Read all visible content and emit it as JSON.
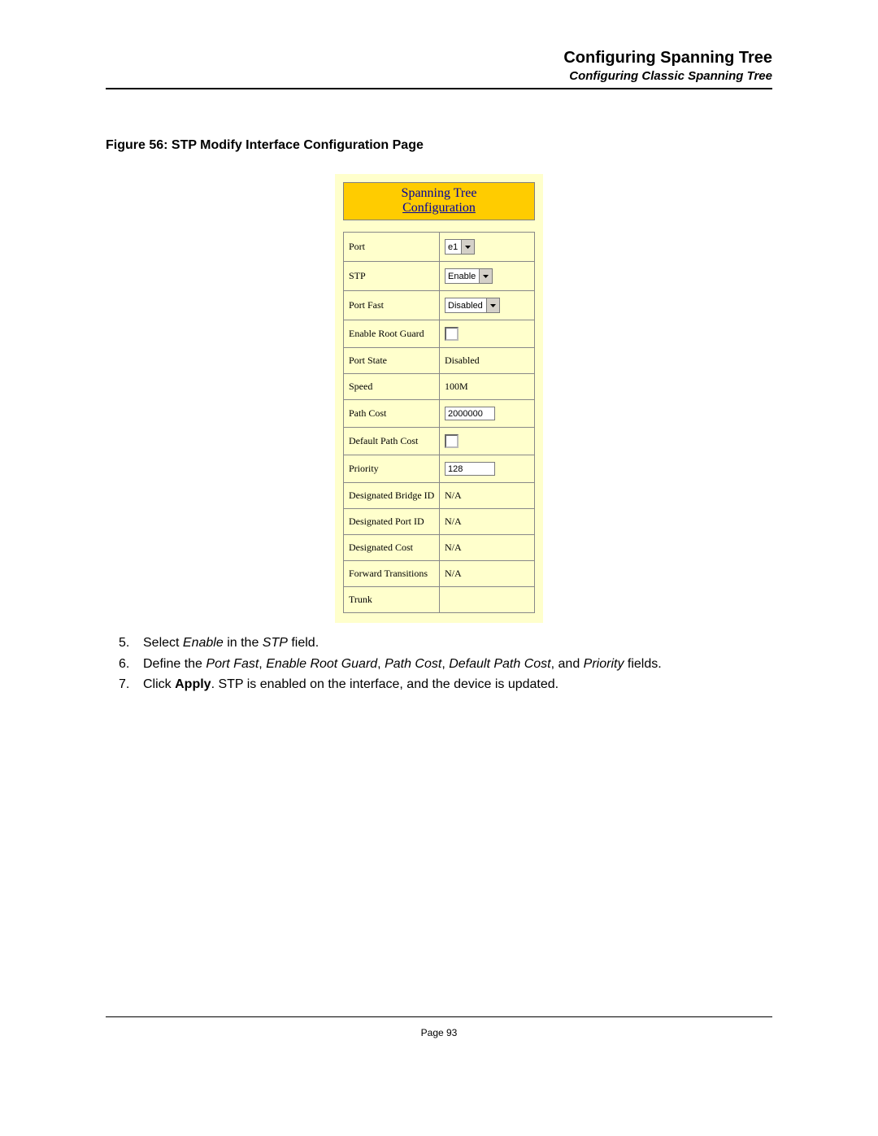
{
  "header": {
    "title": "Configuring Spanning Tree",
    "subtitle": "Configuring Classic Spanning Tree"
  },
  "figure": {
    "caption": "Figure 56:  STP Modify Interface Configuration Page"
  },
  "panel": {
    "title_line1": "Spanning Tree",
    "title_line2": "Configuration",
    "rows": {
      "port": {
        "label": "Port",
        "value": "e1"
      },
      "stp": {
        "label": "STP",
        "value": "Enable"
      },
      "port_fast": {
        "label": "Port Fast",
        "value": "Disabled"
      },
      "root_guard": {
        "label": "Enable Root Guard",
        "checked": false
      },
      "port_state": {
        "label": "Port State",
        "value": "Disabled"
      },
      "speed": {
        "label": "Speed",
        "value": "100M"
      },
      "path_cost": {
        "label": "Path Cost",
        "value": "2000000"
      },
      "default_path_cost": {
        "label": "Default Path Cost",
        "checked": false
      },
      "priority": {
        "label": "Priority",
        "value": "128"
      },
      "des_bridge": {
        "label": "Designated Bridge ID",
        "value": "N/A"
      },
      "des_port": {
        "label": "Designated Port ID",
        "value": "N/A"
      },
      "des_cost": {
        "label": "Designated Cost",
        "value": "N/A"
      },
      "fwd_trans": {
        "label": "Forward Transitions",
        "value": "N/A"
      },
      "trunk": {
        "label": "Trunk",
        "value": ""
      }
    }
  },
  "steps": {
    "s5_num": "5.",
    "s5_a": "Select ",
    "s5_i1": "Enable",
    "s5_b": " in the ",
    "s5_i2": "STP",
    "s5_c": " field.",
    "s6_num": "6.",
    "s6_a": "Define the ",
    "s6_i1": "Port Fast",
    "s6_c1": ", ",
    "s6_i2": "Enable Root Guard",
    "s6_c2": ", ",
    "s6_i3": "Path Cost",
    "s6_c3": ", ",
    "s6_i4": "Default Path Cost",
    "s6_c4": ", and ",
    "s6_i5": "Priority",
    "s6_b": " fields.",
    "s7_num": "7.",
    "s7_a": "Click ",
    "s7_bold": "Apply",
    "s7_b": ". STP is enabled on the interface, and the device is updated."
  },
  "footer": {
    "page": "Page 93"
  }
}
